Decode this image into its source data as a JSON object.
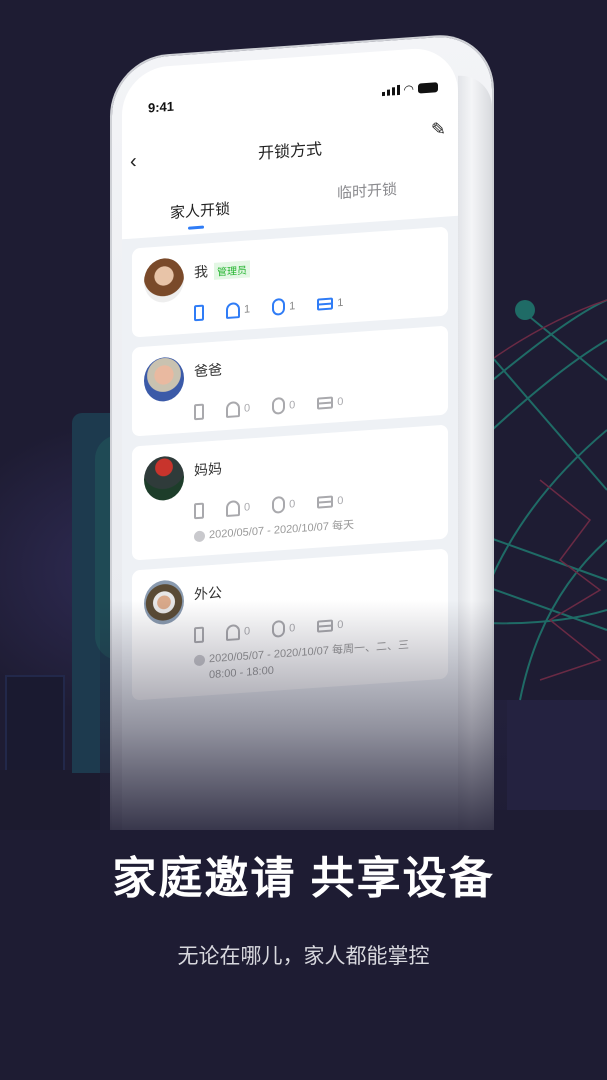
{
  "phone": {
    "status_time": "9:41",
    "nav": {
      "back_icon": "chevron-left-icon",
      "title": "开锁方式",
      "edit_icon": "pencil-icon"
    },
    "tabs": [
      {
        "label": "家人开锁",
        "active": true
      },
      {
        "label": "临时开锁",
        "active": false
      }
    ],
    "members": [
      {
        "name": "我",
        "badge": "管理员",
        "active": true,
        "phone": "",
        "fingerprint": "1",
        "password": "1",
        "card": "1",
        "schedule": ""
      },
      {
        "name": "爸爸",
        "badge": "",
        "active": false,
        "phone": "",
        "fingerprint": "0",
        "password": "0",
        "card": "0",
        "schedule": ""
      },
      {
        "name": "妈妈",
        "badge": "",
        "active": false,
        "phone": "",
        "fingerprint": "0",
        "password": "0",
        "card": "0",
        "schedule": "2020/05/07 - 2020/10/07  每天"
      },
      {
        "name": "外公",
        "badge": "",
        "active": false,
        "phone": "",
        "fingerprint": "0",
        "password": "0",
        "card": "0",
        "schedule": "2020/05/07 - 2020/10/07  每周一、二、三  08:00 - 18:00"
      }
    ]
  },
  "promo": {
    "headline": "家庭邀请 共享设备",
    "subline": "无论在哪儿，家人都能掌控"
  },
  "colors": {
    "accent": "#2f7cf6",
    "badge_green": "#27b532",
    "background": "#1e1c33"
  }
}
